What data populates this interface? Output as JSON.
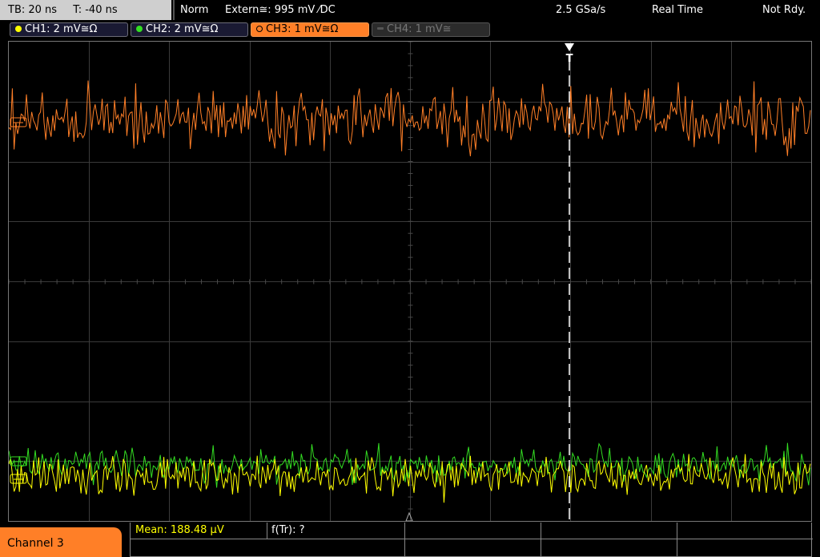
{
  "topbar": {
    "timebase": "TB: 20 ns",
    "trigger_time": "T: -40 ns",
    "mode": "Norm",
    "trigger_source": "Extern≅: 995 mV ⁄DC",
    "sample_rate": "2.5 GSa/s",
    "acquisition": "Real Time",
    "status": "Not Rdy."
  },
  "channels": [
    {
      "label": "CH1: 2 mV≅Ω",
      "color": "#ffff00"
    },
    {
      "label": "CH2: 2 mV≅Ω",
      "color": "#33dd22"
    },
    {
      "label": "CH3: 1 mV≅Ω",
      "color": "#ff7f27"
    },
    {
      "label": "CH4: 1 mV≅",
      "color": "#666666"
    }
  ],
  "trigger_marker": "T",
  "bottom": {
    "channel_label": "Channel 3",
    "mean": "Mean: 188.48 µV",
    "f_tr": "f(Tr): ?"
  },
  "colors": {
    "ch1": "#ffff00",
    "ch2": "#33dd22",
    "ch3": "#ff7f27",
    "accent": "#ff7f27"
  }
}
